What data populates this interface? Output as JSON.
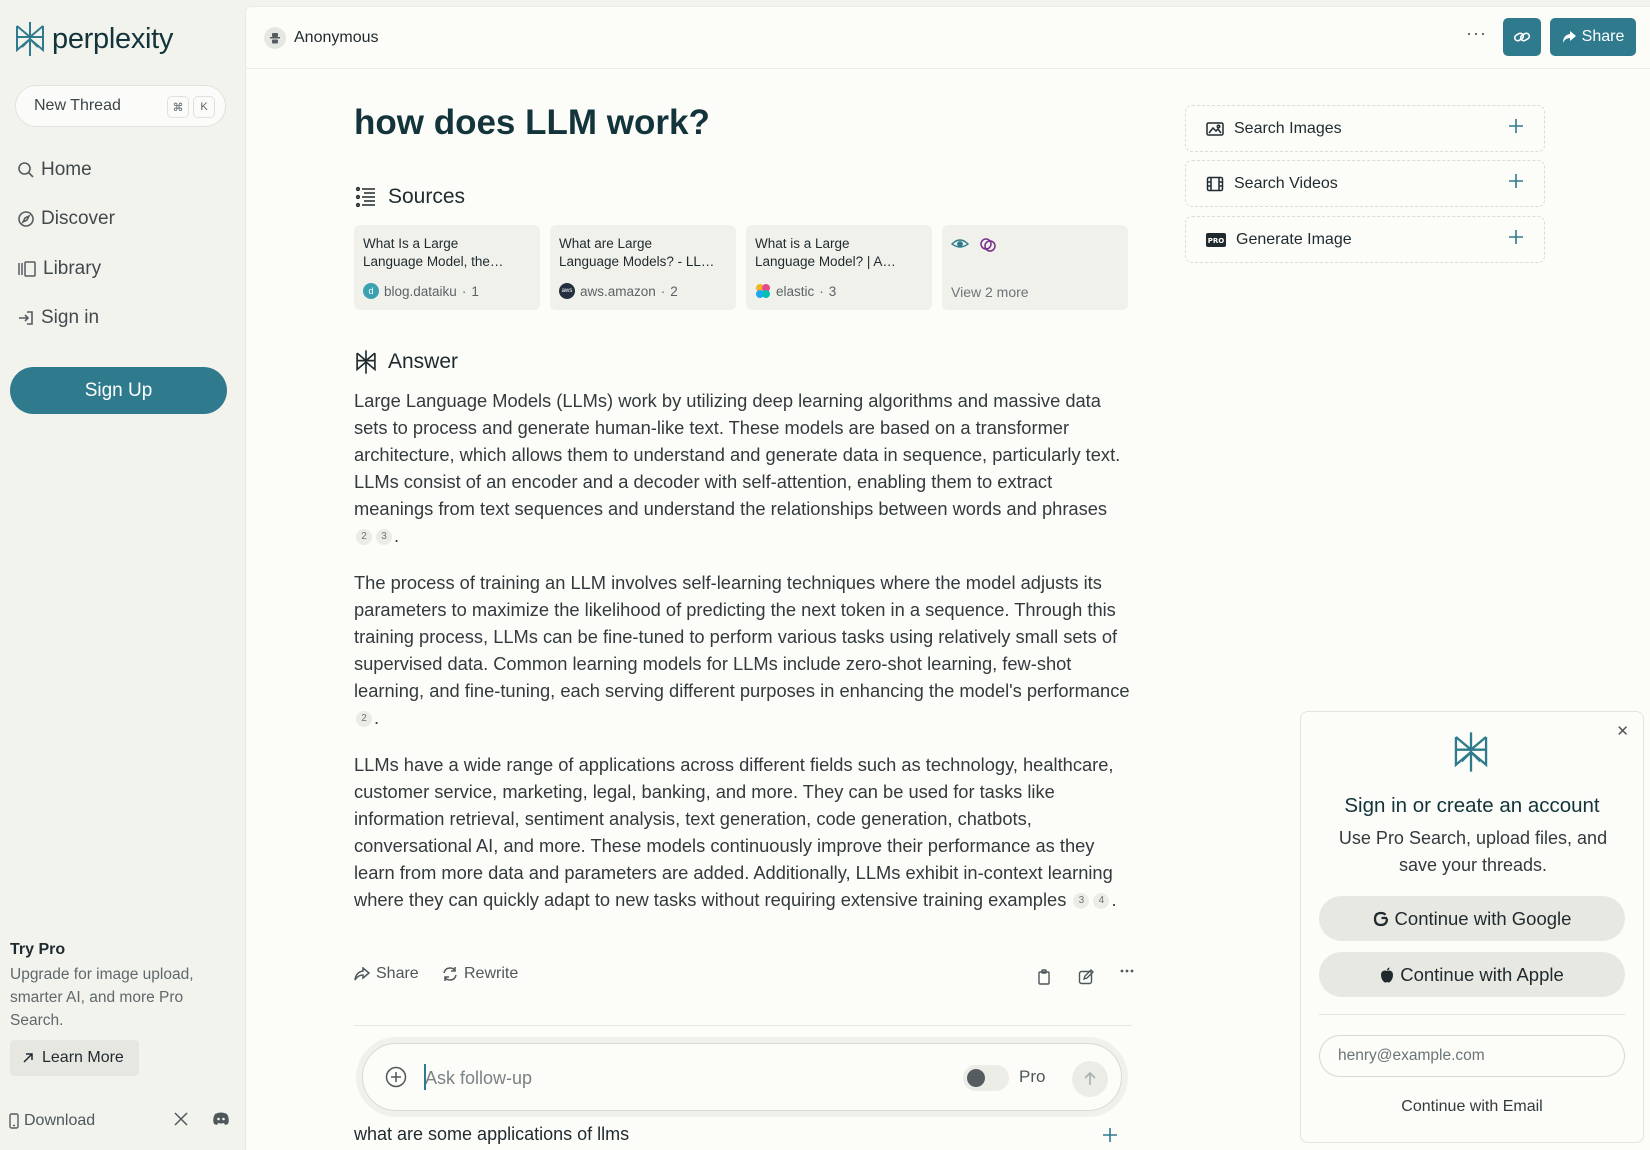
{
  "brand": {
    "name": "perplexity",
    "accent": "#2f7a8c"
  },
  "sidebar": {
    "new_thread": {
      "label": "New Thread",
      "shortcut_cmd": "⌘",
      "shortcut_key": "K"
    },
    "nav": [
      {
        "label": "Home",
        "icon": "search-icon"
      },
      {
        "label": "Discover",
        "icon": "compass-icon"
      },
      {
        "label": "Library",
        "icon": "library-icon"
      },
      {
        "label": "Sign in",
        "icon": "sign-in-icon"
      }
    ],
    "signup_label": "Sign Up",
    "try_pro": {
      "title": "Try Pro",
      "description": "Upgrade for image upload, smarter AI, and more Pro Search.",
      "learn_more": "Learn More"
    },
    "download_label": "Download"
  },
  "header": {
    "user": "Anonymous",
    "more": "···",
    "share_label": "Share"
  },
  "thread": {
    "query": "how does LLM work?",
    "sources_heading": "Sources",
    "sources": [
      {
        "title_line1": "What Is a Large",
        "title_line2": "Language Model, the…",
        "domain": "blog.dataiku",
        "index": "1",
        "favicon_color": "#3aa2b0",
        "favicon_letter": "d"
      },
      {
        "title_line1": "What are Large",
        "title_line2": "Language Models? - LL…",
        "domain": "aws.amazon",
        "index": "2",
        "favicon_color": "#232f3e",
        "favicon_letter": "aws"
      },
      {
        "title_line1": "What is a Large",
        "title_line2": "Language Model? | A…",
        "domain": "elastic",
        "index": "3",
        "favicon_color": "#f0b428",
        "favicon_letter": ""
      }
    ],
    "view_more": "View 2 more",
    "answer_heading": "Answer",
    "answer": {
      "p1": "Large Language Models (LLMs) work by utilizing deep learning algorithms and massive data sets to process and generate human-like text. These models are based on a transformer architecture, which allows them to understand and generate data in sequence, particularly text. LLMs consist of an encoder and a decoder with self-attention, enabling them to extract meanings from text sequences and understand the relationships between words and phrases",
      "p1_cites": [
        "2",
        "3"
      ],
      "p2": "The process of training an LLM involves self-learning techniques where the model adjusts its parameters to maximize the likelihood of predicting the next token in a sequence. Through this training process, LLMs can be fine-tuned to perform various tasks using relatively small sets of supervised data. Common learning models for LLMs include zero-shot learning, few-shot learning, and fine-tuning, each serving different purposes in enhancing the model's performance",
      "p2_cites": [
        "2"
      ],
      "p3": "LLMs have a wide range of applications across different fields such as technology, healthcare, customer service, marketing, legal, banking, and more. They can be used for tasks like information retrieval, sentiment analysis, text generation, code generation, chatbots, conversational AI, and more. These models continuously improve their performance as they learn from more data and parameters are added. Additionally, LLMs exhibit in-context learning where they can quickly adapt to new tasks without requiring extensive training examples",
      "p3_cites": [
        "3",
        "4"
      ],
      "period": "."
    },
    "actions": {
      "share": "Share",
      "rewrite": "Rewrite"
    },
    "followup": {
      "placeholder": "Ask follow-up",
      "pro_label": "Pro"
    },
    "related": "what are some applications of llms"
  },
  "tools": [
    {
      "label": "Search Images",
      "icon": "image-icon"
    },
    {
      "label": "Search Videos",
      "icon": "film-icon"
    },
    {
      "label": "Generate Image",
      "icon": "pro-badge-icon"
    }
  ],
  "signin_modal": {
    "title": "Sign in or create an account",
    "subtitle": "Use Pro Search, upload files, and save your threads.",
    "google": "Continue with Google",
    "apple": "Continue with Apple",
    "email_placeholder": "henry@example.com",
    "email_button": "Continue with Email"
  }
}
